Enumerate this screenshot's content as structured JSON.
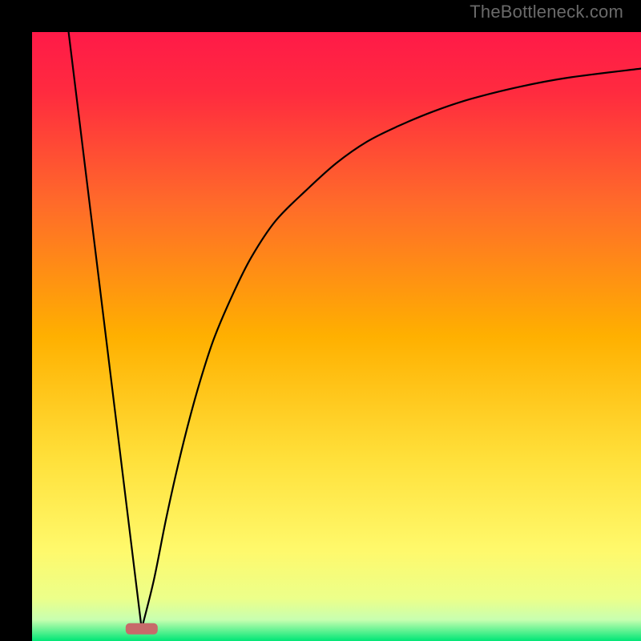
{
  "watermark": "TheBottleneck.com",
  "chart_data": {
    "type": "line",
    "xlim": [
      0,
      100
    ],
    "ylim": [
      0,
      100
    ],
    "grid": false,
    "background_gradient": {
      "top": "#ff1744",
      "upper_mid": "#ff5030",
      "mid": "#ffb300",
      "lower_mid": "#ffee58",
      "near_bottom": "#f4ff81",
      "bottom": "#00e676"
    },
    "marker": {
      "x": 18,
      "y": 2,
      "color": "#c76a6a",
      "shape": "rounded-bar"
    },
    "series": [
      {
        "name": "left-line",
        "x": [
          6,
          18
        ],
        "y": [
          100,
          2
        ]
      },
      {
        "name": "right-curve",
        "x": [
          18,
          20,
          22,
          24,
          26,
          28,
          30,
          33,
          36,
          40,
          45,
          50,
          55,
          60,
          66,
          72,
          80,
          88,
          100
        ],
        "y": [
          2,
          10,
          20,
          29,
          37,
          44,
          50,
          57,
          63,
          69,
          74,
          78.5,
          82,
          84.5,
          87,
          89,
          91,
          92.5,
          94
        ]
      }
    ]
  }
}
